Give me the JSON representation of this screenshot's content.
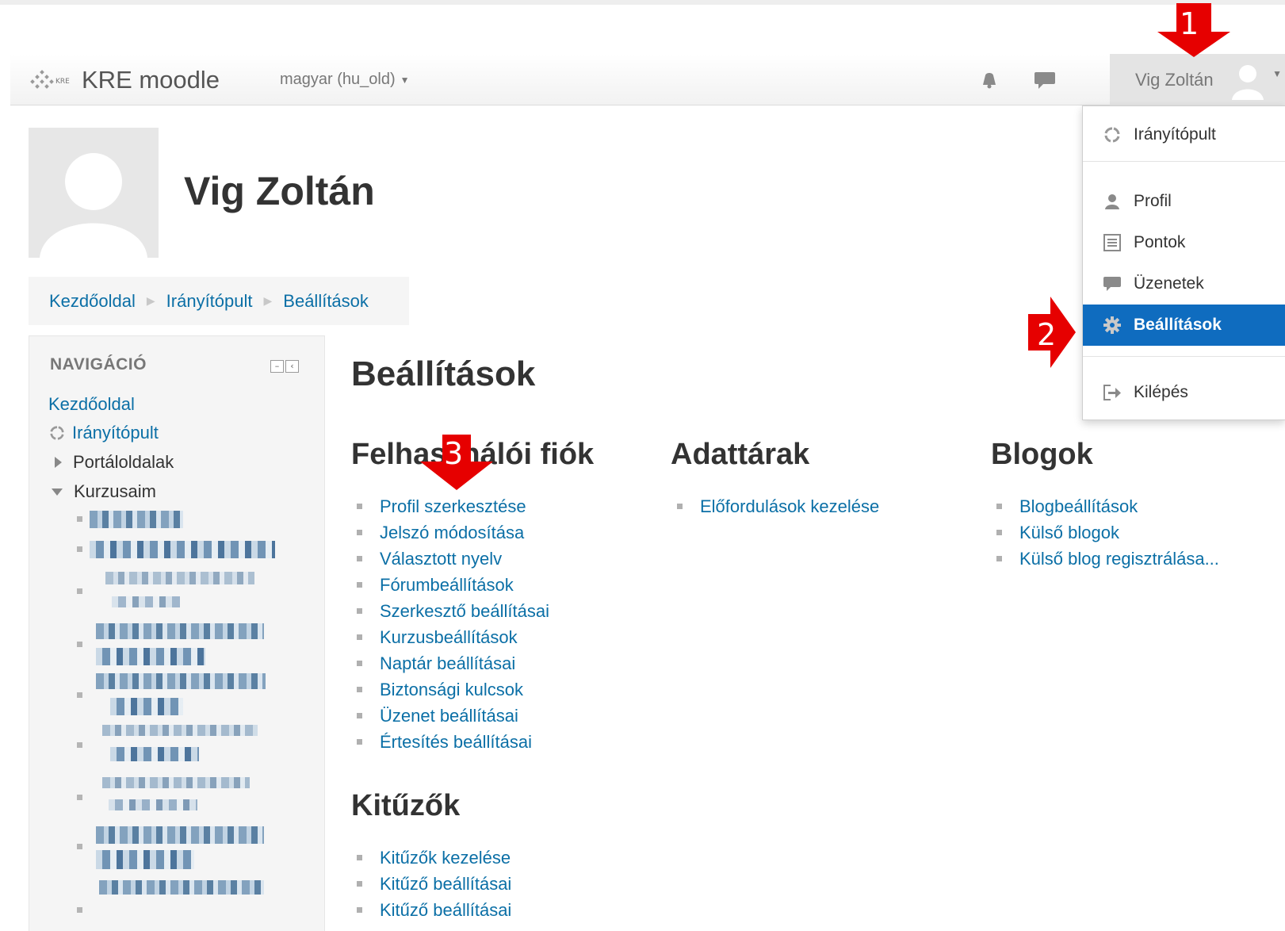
{
  "navbar": {
    "brand": "KRE moodle",
    "language": "magyar (hu_old)",
    "user_name": "Vig Zoltán",
    "icons": [
      "notifications-icon",
      "messages-icon"
    ]
  },
  "user_menu": {
    "items": [
      {
        "label": "Irányítópult",
        "icon": "dashboard-icon"
      },
      {
        "label": "Profil",
        "icon": "user-icon"
      },
      {
        "label": "Pontok",
        "icon": "grades-icon"
      },
      {
        "label": "Üzenetek",
        "icon": "messages-icon"
      },
      {
        "label": "Beállítások",
        "icon": "gear-icon",
        "active": true
      },
      {
        "label": "Kilépés",
        "icon": "logout-icon"
      }
    ]
  },
  "page": {
    "user_name": "Vig Zoltán"
  },
  "breadcrumb": [
    "Kezdőoldal",
    "Irányítópult",
    "Beállítások"
  ],
  "navigation": {
    "title": "NAVIGÁCIÓ",
    "home": "Kezdőoldal",
    "dashboard": "Irányítópult",
    "site_pages": "Portáloldalak",
    "my_courses": "Kurzusaim"
  },
  "main": {
    "title": "Beállítások",
    "sections": {
      "account": {
        "title": "Felhasználói fiók",
        "links": [
          "Profil szerkesztése",
          "Jelszó módosítása",
          "Választott nyelv",
          "Fórumbeállítások",
          "Szerkesztő beállításai",
          "Kurzusbeállítások",
          "Naptár beállításai",
          "Biztonsági kulcsok",
          "Üzenet beállításai",
          "Értesítés beállításai"
        ]
      },
      "repositories": {
        "title": "Adattárak",
        "links": [
          "Előfordulások kezelése"
        ]
      },
      "blogs": {
        "title": "Blogok",
        "links": [
          "Blogbeállítások",
          "Külső blogok",
          "Külső blog regisztrálása..."
        ]
      },
      "badges": {
        "title": "Kitűzők",
        "links": [
          "Kitűzők kezelése",
          "Kitűző beállításai",
          "Kitűző beállításai"
        ]
      }
    }
  },
  "annotations": [
    "1",
    "2",
    "3"
  ],
  "colors": {
    "link": "#0b6fa6",
    "active_menu": "#0f6cbf",
    "annotation": "#e60000"
  }
}
